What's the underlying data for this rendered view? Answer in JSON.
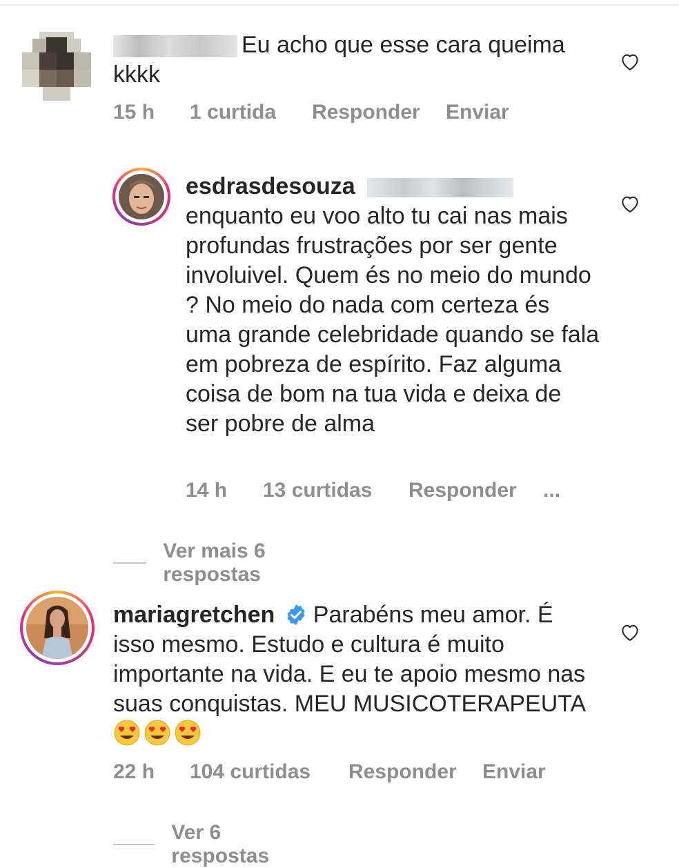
{
  "comments": [
    {
      "username": "",
      "text": "Eu acho que esse cara queima kkkk",
      "time": "15 h",
      "likes": "1 curtida",
      "reply": "Responder",
      "send": "Enviar"
    },
    {
      "username": "esdrasdesouza",
      "text": "enquanto eu voo alto tu cai nas mais profundas frustrações por ser gente involuivel. Quem és no meio do mundo ? No meio do nada com certeza és uma grande celebridade quando se fala em pobreza de espírito. Faz alguma coisa de bom na tua vida e deixa de ser pobre de alma",
      "time": "14 h",
      "likes": "13 curtidas",
      "reply": "Responder",
      "more": "...",
      "view_more": "Ver mais 6 respostas"
    },
    {
      "username": "mariagretchen",
      "text": "Parabéns meu amor. É isso mesmo. Estudo e cultura é muito importante na vida. E eu te apoio mesmo nas suas conquistas. MEU MUSICOTERAPEUTA",
      "time": "22 h",
      "likes": "104 curtidas",
      "reply": "Responder",
      "send": "Enviar",
      "view_more": "Ver 6 respostas"
    }
  ],
  "colors": {
    "verified": "#3897f0",
    "secondary_text": "#8e8e8e"
  },
  "icons": [
    "heart-outline-icon",
    "verified-badge-icon",
    "heart-eyes-emoji"
  ]
}
